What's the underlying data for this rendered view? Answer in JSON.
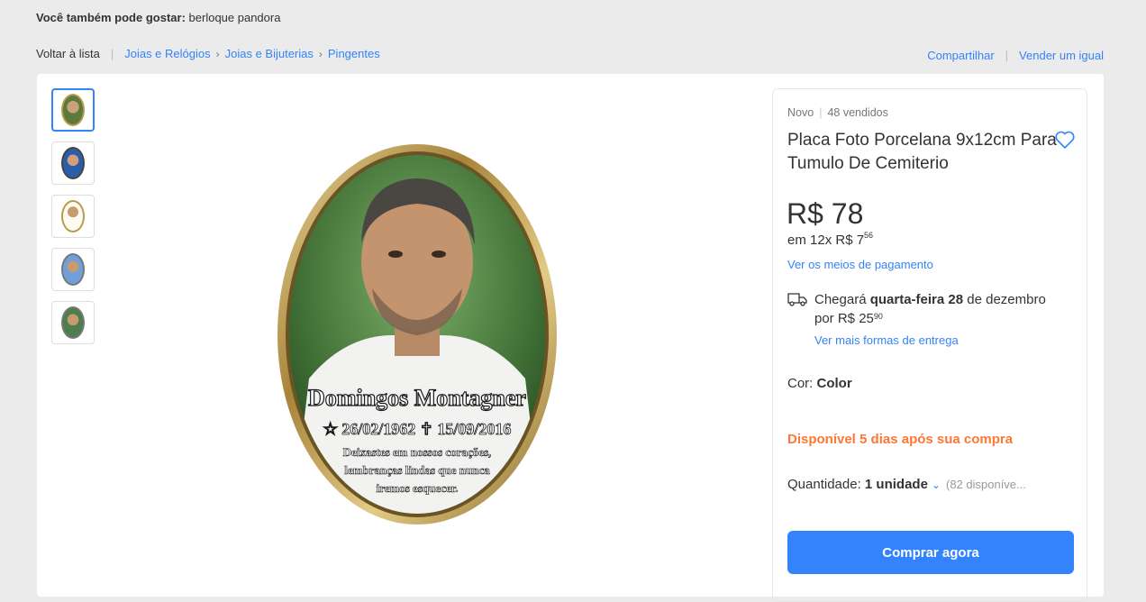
{
  "suggestion": {
    "label": "Você também pode gostar:",
    "value": "berloque pandora"
  },
  "breadcrumb": {
    "back": "Voltar à lista",
    "items": [
      "Joias e Relógios",
      "Joias e Bijuterias",
      "Pingentes"
    ]
  },
  "actions": {
    "share": "Compartilhar",
    "sell": "Vender um igual"
  },
  "thumbnails": {
    "count": 5,
    "active_index": 0
  },
  "hero": {
    "name": "Domingos Montagner",
    "dates": "☆ 26/02/1962   ✝ 15/09/2016",
    "epitaph_1": "Deixastes em nossos corações,",
    "epitaph_2": "lembranças lindas que nunca",
    "epitaph_3": "iremos esquecer."
  },
  "product": {
    "condition": "Novo",
    "sold": "48 vendidos",
    "title": "Placa Foto Porcelana 9x12cm Para Tumulo De Cemiterio",
    "price": "R$ 78",
    "installments_prefix": "em 12x R$ 7",
    "installments_cents": "56",
    "payment_link": "Ver os meios de pagamento",
    "shipping_pre": "Chegará",
    "shipping_day": "quarta-feira 28",
    "shipping_mid": "de dezembro",
    "shipping_price_prefix": "por R$ 25",
    "shipping_price_cents": "90",
    "shipping_link": "Ver mais formas de entrega",
    "color_label": "Cor:",
    "color_value": "Color",
    "availability_pre": "Disponível",
    "availability_days": "5",
    "availability_post": "dias após sua compra",
    "qty_label": "Quantidade:",
    "qty_value": "1 unidade",
    "qty_stock": "(82 disponíve...",
    "buy_label": "Comprar agora"
  },
  "colors": {
    "accent": "#3483fa",
    "availability": "#ff7733",
    "frame": "#b89a4a"
  }
}
